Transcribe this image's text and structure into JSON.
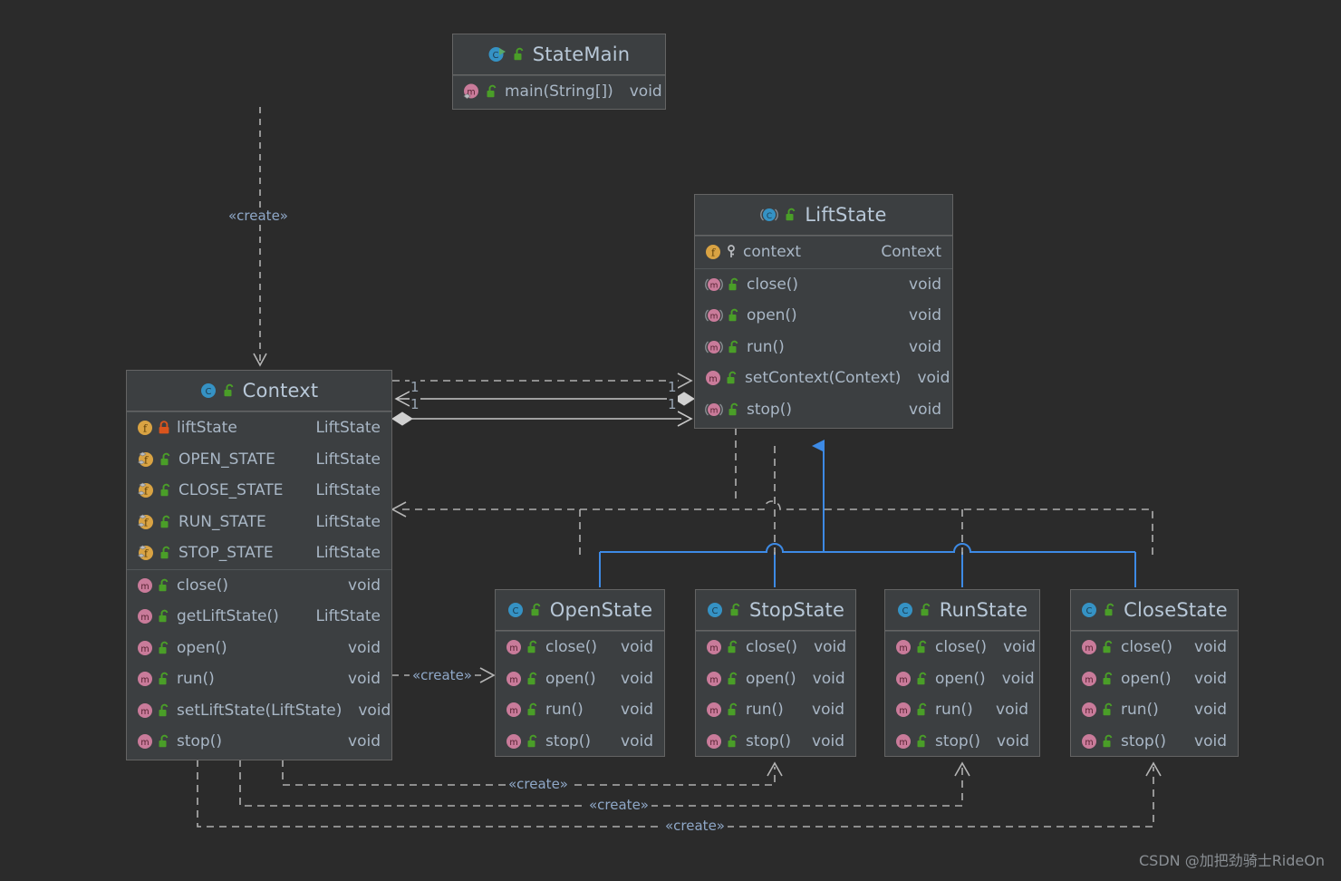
{
  "diagram": {
    "kind": "uml-class-diagram",
    "background": "#2b2b2b",
    "colors": {
      "box_fill": "#3c3f41",
      "box_border": "#646464",
      "text": "#a9b7c6",
      "title_text": "#b8c8d8",
      "stereotype_text": "#8fa8c8",
      "inheritance_line": "#3d8ae5",
      "dependency_line": "#b0b0b0",
      "association_line": "#c8c8c8",
      "icon_class": "#3592c4",
      "icon_field": "#d9a343",
      "icon_method": "#c97b9a",
      "icon_lock_public": "#4a9e28",
      "icon_lock_private": "#d9541d",
      "icon_run": "#59a869"
    }
  },
  "watermark": "CSDN @加把劲骑士RideOn",
  "classes": [
    {
      "id": "statemain",
      "name": "StateMain",
      "icon": "class-runnable-icon",
      "visibility_icon": "unlock-public-icon",
      "abstract": false,
      "sections": [
        {
          "kind": "methods",
          "rows": [
            {
              "icon": "method-override-icon",
              "lock": "unlock-public-icon",
              "name": "main(String[])",
              "type": "void"
            }
          ]
        }
      ]
    },
    {
      "id": "liftstate",
      "name": "LiftState",
      "icon": "class-abstract-icon",
      "visibility_icon": "unlock-public-icon",
      "abstract": true,
      "sections": [
        {
          "kind": "fields",
          "rows": [
            {
              "icon": "field-icon",
              "lock": "key-protected-icon",
              "name": "context",
              "type": "Context"
            }
          ]
        },
        {
          "kind": "methods",
          "rows": [
            {
              "icon": "method-abstract-icon",
              "lock": "unlock-public-icon",
              "name": "close()",
              "type": "void"
            },
            {
              "icon": "method-abstract-icon",
              "lock": "unlock-public-icon",
              "name": "open()",
              "type": "void"
            },
            {
              "icon": "method-abstract-icon",
              "lock": "unlock-public-icon",
              "name": "run()",
              "type": "void"
            },
            {
              "icon": "method-icon",
              "lock": "unlock-public-icon",
              "name": "setContext(Context)",
              "type": "void"
            },
            {
              "icon": "method-abstract-icon",
              "lock": "unlock-public-icon",
              "name": "stop()",
              "type": "void"
            }
          ]
        }
      ]
    },
    {
      "id": "context",
      "name": "Context",
      "icon": "class-icon",
      "visibility_icon": "unlock-public-icon",
      "abstract": false,
      "sections": [
        {
          "kind": "fields",
          "rows": [
            {
              "icon": "field-icon",
              "lock": "lock-private-icon",
              "name": "liftState",
              "type": "LiftState"
            },
            {
              "icon": "field-static-icon",
              "lock": "unlock-public-icon",
              "name": "OPEN_STATE",
              "type": "LiftState"
            },
            {
              "icon": "field-static-icon",
              "lock": "unlock-public-icon",
              "name": "CLOSE_STATE",
              "type": "LiftState"
            },
            {
              "icon": "field-static-icon",
              "lock": "unlock-public-icon",
              "name": "RUN_STATE",
              "type": "LiftState"
            },
            {
              "icon": "field-static-icon",
              "lock": "unlock-public-icon",
              "name": "STOP_STATE",
              "type": "LiftState"
            }
          ]
        },
        {
          "kind": "methods",
          "rows": [
            {
              "icon": "method-icon",
              "lock": "unlock-public-icon",
              "name": "close()",
              "type": "void"
            },
            {
              "icon": "method-icon",
              "lock": "unlock-public-icon",
              "name": "getLiftState()",
              "type": "LiftState"
            },
            {
              "icon": "method-icon",
              "lock": "unlock-public-icon",
              "name": "open()",
              "type": "void"
            },
            {
              "icon": "method-icon",
              "lock": "unlock-public-icon",
              "name": "run()",
              "type": "void"
            },
            {
              "icon": "method-icon",
              "lock": "unlock-public-icon",
              "name": "setLiftState(LiftState)",
              "type": "void"
            },
            {
              "icon": "method-icon",
              "lock": "unlock-public-icon",
              "name": "stop()",
              "type": "void"
            }
          ]
        }
      ]
    },
    {
      "id": "openstate",
      "name": "OpenState",
      "icon": "class-icon",
      "visibility_icon": "unlock-public-icon",
      "abstract": false,
      "sections": [
        {
          "kind": "methods",
          "rows": [
            {
              "icon": "method-icon",
              "lock": "unlock-public-icon",
              "name": "close()",
              "type": "void"
            },
            {
              "icon": "method-icon",
              "lock": "unlock-public-icon",
              "name": "open()",
              "type": "void"
            },
            {
              "icon": "method-icon",
              "lock": "unlock-public-icon",
              "name": "run()",
              "type": "void"
            },
            {
              "icon": "method-icon",
              "lock": "unlock-public-icon",
              "name": "stop()",
              "type": "void"
            }
          ]
        }
      ]
    },
    {
      "id": "stopstate",
      "name": "StopState",
      "icon": "class-icon",
      "visibility_icon": "unlock-public-icon",
      "abstract": false,
      "sections": [
        {
          "kind": "methods",
          "rows": [
            {
              "icon": "method-icon",
              "lock": "unlock-public-icon",
              "name": "close()",
              "type": "void"
            },
            {
              "icon": "method-icon",
              "lock": "unlock-public-icon",
              "name": "open()",
              "type": "void"
            },
            {
              "icon": "method-icon",
              "lock": "unlock-public-icon",
              "name": "run()",
              "type": "void"
            },
            {
              "icon": "method-icon",
              "lock": "unlock-public-icon",
              "name": "stop()",
              "type": "void"
            }
          ]
        }
      ]
    },
    {
      "id": "runstate",
      "name": "RunState",
      "icon": "class-icon",
      "visibility_icon": "unlock-public-icon",
      "abstract": false,
      "sections": [
        {
          "kind": "methods",
          "rows": [
            {
              "icon": "method-icon",
              "lock": "unlock-public-icon",
              "name": "close()",
              "type": "void"
            },
            {
              "icon": "method-icon",
              "lock": "unlock-public-icon",
              "name": "open()",
              "type": "void"
            },
            {
              "icon": "method-icon",
              "lock": "unlock-public-icon",
              "name": "run()",
              "type": "void"
            },
            {
              "icon": "method-icon",
              "lock": "unlock-public-icon",
              "name": "stop()",
              "type": "void"
            }
          ]
        }
      ]
    },
    {
      "id": "closestate",
      "name": "CloseState",
      "icon": "class-icon",
      "visibility_icon": "unlock-public-icon",
      "abstract": false,
      "sections": [
        {
          "kind": "methods",
          "rows": [
            {
              "icon": "method-icon",
              "lock": "unlock-public-icon",
              "name": "close()",
              "type": "void"
            },
            {
              "icon": "method-icon",
              "lock": "unlock-public-icon",
              "name": "open()",
              "type": "void"
            },
            {
              "icon": "method-icon",
              "lock": "unlock-public-icon",
              "name": "run()",
              "type": "void"
            },
            {
              "icon": "method-icon",
              "lock": "unlock-public-icon",
              "name": "stop()",
              "type": "void"
            }
          ]
        }
      ]
    }
  ],
  "edge_labels": {
    "create_statemain_context": "«create»",
    "create_context_openstate": "«create»",
    "create_context_stopstate": "«create»",
    "create_context_runstate": "«create»",
    "create_context_closestate": "«create»",
    "mult_dep_left": "1",
    "mult_dep_right": "1",
    "mult_assoc_left": "1",
    "mult_assoc_right": "1"
  },
  "relations": [
    {
      "from": "StateMain",
      "to": "Context",
      "type": "dependency",
      "label": "«create»"
    },
    {
      "from": "Context",
      "to": "LiftState",
      "type": "dependency",
      "label": "",
      "source_mult": "1",
      "target_mult": "1"
    },
    {
      "from": "LiftState",
      "to": "Context",
      "type": "association",
      "label": "",
      "source_mult": "1",
      "target_mult": "1"
    },
    {
      "from": "Context",
      "to": "LiftState",
      "type": "aggregation",
      "label": ""
    },
    {
      "from": "OpenState",
      "to": "LiftState",
      "type": "generalization"
    },
    {
      "from": "StopState",
      "to": "LiftState",
      "type": "generalization"
    },
    {
      "from": "RunState",
      "to": "LiftState",
      "type": "generalization"
    },
    {
      "from": "CloseState",
      "to": "LiftState",
      "type": "generalization"
    },
    {
      "from": "Context",
      "to": "OpenState",
      "type": "dependency",
      "label": "«create»"
    },
    {
      "from": "Context",
      "to": "StopState",
      "type": "dependency",
      "label": "«create»"
    },
    {
      "from": "Context",
      "to": "RunState",
      "type": "dependency",
      "label": "«create»"
    },
    {
      "from": "Context",
      "to": "CloseState",
      "type": "dependency",
      "label": "«create»"
    },
    {
      "from": "OpenState",
      "to": "Context",
      "type": "dependency",
      "label": ""
    }
  ]
}
